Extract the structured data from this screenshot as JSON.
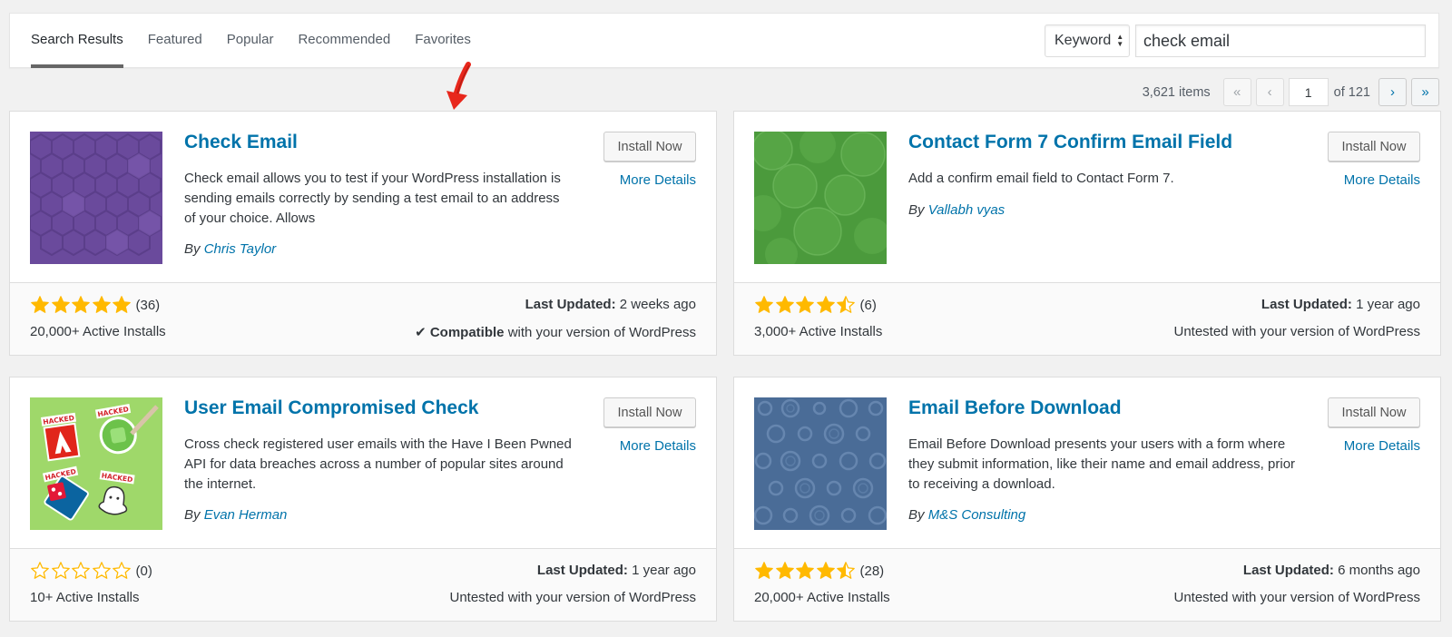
{
  "filter": {
    "tabs": [
      {
        "label": "Search Results",
        "active": true
      },
      {
        "label": "Featured",
        "active": false
      },
      {
        "label": "Popular",
        "active": false
      },
      {
        "label": "Recommended",
        "active": false
      },
      {
        "label": "Favorites",
        "active": false
      }
    ],
    "search_type": "Keyword",
    "search_value": "check email"
  },
  "pagination": {
    "items": "3,621 items",
    "first": "«",
    "prev": "‹",
    "current_page": "1",
    "of_total": "of 121",
    "next": "›",
    "last": "»"
  },
  "plugins": [
    {
      "name": "Check Email",
      "description": "Check email allows you to test if your WordPress installation is sending emails correctly by sending a test email to an address of your choice. Allows",
      "author_prefix": "By",
      "author": "Chris Taylor",
      "install_label": "Install Now",
      "more_details": "More Details",
      "rating": 5,
      "num_ratings": "(36)",
      "active_installs": "20,000+ Active Installs",
      "last_updated_label": "Last Updated:",
      "last_updated": "2 weeks ago",
      "compat_strong": "Compatible",
      "compat_text": "with your version of WordPress",
      "icon": "purple-hexagon-pattern",
      "icon_color": "#6a4a9c"
    },
    {
      "name": "Contact Form 7 Confirm Email Field",
      "description": "Add a confirm email field to Contact Form 7.",
      "author_prefix": "By",
      "author": "Vallabh vyas",
      "install_label": "Install Now",
      "more_details": "More Details",
      "rating": 4.5,
      "num_ratings": "(6)",
      "active_installs": "3,000+ Active Installs",
      "last_updated_label": "Last Updated:",
      "last_updated": "1 year ago",
      "compat_strong": "",
      "compat_text": "Untested with your version of WordPress",
      "icon": "green-circle-pattern",
      "icon_color": "#4b9a3c"
    },
    {
      "name": "User Email Compromised Check",
      "description": "Cross check registered user emails with the Have I Been Pwned API for data breaches across a number of popular sites around the internet.",
      "author_prefix": "By",
      "author": "Evan Herman",
      "install_label": "Install Now",
      "more_details": "More Details",
      "rating": 0,
      "num_ratings": "(0)",
      "active_installs": "10+ Active Installs",
      "last_updated_label": "Last Updated:",
      "last_updated": "1 year ago",
      "compat_strong": "",
      "compat_text": "Untested with your version of WordPress",
      "icon": "hacked-stickers",
      "icon_color": "#9fd86a",
      "icon_sticker_text": "HACKED"
    },
    {
      "name": "Email Before Download",
      "description": "Email Before Download presents your users with a form where they submit information, like their name and email address, prior to receiving a download.",
      "author_prefix": "By",
      "author": "M&S Consulting",
      "install_label": "Install Now",
      "more_details": "More Details",
      "rating": 4.5,
      "num_ratings": "(28)",
      "active_installs": "20,000+ Active Installs",
      "last_updated_label": "Last Updated:",
      "last_updated": "6 months ago",
      "compat_strong": "",
      "compat_text": "Untested with your version of WordPress",
      "icon": "blue-ring-pattern",
      "icon_color": "#4a6c97"
    }
  ],
  "colors": {
    "link": "#0073aa",
    "star": "#ffb900",
    "annotation": "#e8271c"
  }
}
